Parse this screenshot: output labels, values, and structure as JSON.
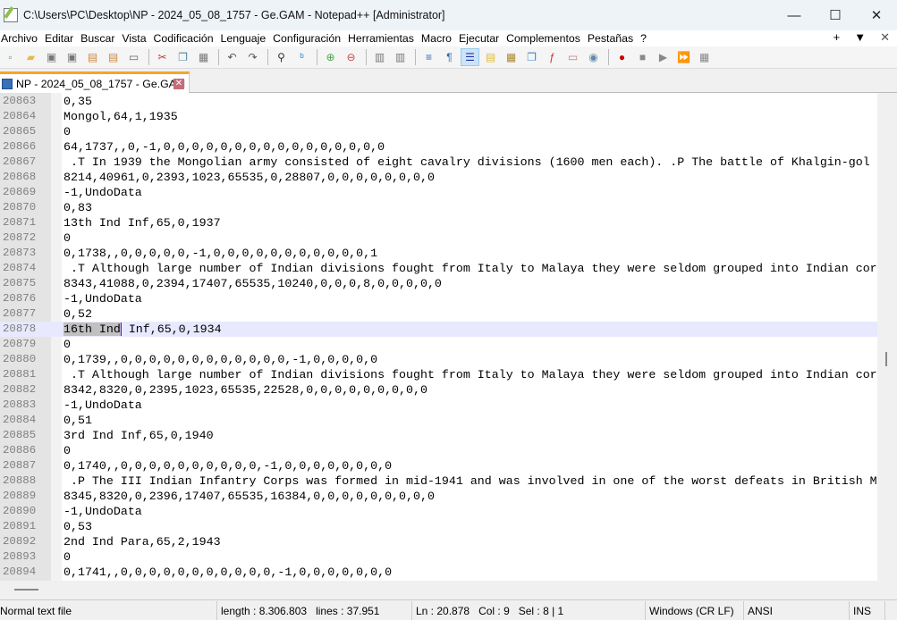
{
  "window": {
    "title": "C:\\Users\\PC\\Desktop\\NP - 2024_05_08_1757 - Ge.GAM - Notepad++ [Administrator]",
    "minimize": "—",
    "maximize": "☐",
    "close": "✕"
  },
  "menu": [
    "Archivo",
    "Editar",
    "Buscar",
    "Vista",
    "Codificación",
    "Lenguaje",
    "Configuración",
    "Herramientas",
    "Macro",
    "Ejecutar",
    "Complementos",
    "Pestañas",
    "?"
  ],
  "menu_right": {
    "add": "+",
    "dropdown": "▼",
    "close": "✕"
  },
  "tab": {
    "label": "NP - 2024_05_08_1757 - Ge.GAM",
    "close": "✕"
  },
  "editor": {
    "lines": [
      {
        "n": "20863",
        "t": "0,35"
      },
      {
        "n": "20864",
        "t": "Mongol,64,1,1935"
      },
      {
        "n": "20865",
        "t": "0"
      },
      {
        "n": "20866",
        "t": "64,1737,,0,-1,0,0,0,0,0,0,0,0,0,0,0,0,0,0,0,0"
      },
      {
        "n": "20867",
        "t": " .T In 1939 the Mongolian army consisted of eight cavalry divisions (1600 men each). .P The battle of Khalgin-gol"
      },
      {
        "n": "20868",
        "t": "8214,40961,0,2393,1023,65535,0,28807,0,0,0,0,0,0,0,0"
      },
      {
        "n": "20869",
        "t": "-1,UndoData"
      },
      {
        "n": "20870",
        "t": "0,83"
      },
      {
        "n": "20871",
        "t": "13th Ind Inf,65,0,1937"
      },
      {
        "n": "20872",
        "t": "0"
      },
      {
        "n": "20873",
        "t": "0,1738,,0,0,0,0,0,-1,0,0,0,0,0,0,0,0,0,0,0,1"
      },
      {
        "n": "20874",
        "t": " .T Although large number of Indian divisions fought from Italy to Malaya they were seldom grouped into Indian cor"
      },
      {
        "n": "20875",
        "t": "8343,41088,0,2394,17407,65535,10240,0,0,0,8,0,0,0,0,0"
      },
      {
        "n": "20876",
        "t": "-1,UndoData"
      },
      {
        "n": "20877",
        "t": "0,52"
      },
      {
        "n": "20878",
        "sel": "16th Ind",
        "t": " Inf,65,0,1934"
      },
      {
        "n": "20879",
        "t": "0"
      },
      {
        "n": "20880",
        "t": "0,1739,,0,0,0,0,0,0,0,0,0,0,0,0,-1,0,0,0,0,0"
      },
      {
        "n": "20881",
        "t": " .T Although large number of Indian divisions fought from Italy to Malaya they were seldom grouped into Indian cor"
      },
      {
        "n": "20882",
        "t": "8342,8320,0,2395,1023,65535,22528,0,0,0,0,0,0,0,0,0"
      },
      {
        "n": "20883",
        "t": "-1,UndoData"
      },
      {
        "n": "20884",
        "t": "0,51"
      },
      {
        "n": "20885",
        "t": "3rd Ind Inf,65,0,1940"
      },
      {
        "n": "20886",
        "t": "0"
      },
      {
        "n": "20887",
        "t": "0,1740,,0,0,0,0,0,0,0,0,0,0,-1,0,0,0,0,0,0,0,0"
      },
      {
        "n": "20888",
        "t": " .P The III Indian Infantry Corps was formed in mid-1941 and was involved in one of the worst defeats in British M"
      },
      {
        "n": "20889",
        "t": "8345,8320,0,2396,17407,65535,16384,0,0,0,0,0,0,0,0,0"
      },
      {
        "n": "20890",
        "t": "-1,UndoData"
      },
      {
        "n": "20891",
        "t": "0,53"
      },
      {
        "n": "20892",
        "t": "2nd Ind Para,65,2,1943"
      },
      {
        "n": "20893",
        "t": "0"
      },
      {
        "n": "20894",
        "t": "0,1741,,0,0,0,0,0,0,0,0,0,0,0,-1,0,0,0,0,0,0,0"
      }
    ]
  },
  "status": {
    "file_type": "Normal text file",
    "length": "length : 8.306.803",
    "lines": "lines : 37.951",
    "ln": "Ln : 20.878",
    "col": "Col : 9",
    "sel": "Sel : 8 | 1",
    "eol": "Windows (CR LF)",
    "encoding": "ANSI",
    "mode": "INS"
  }
}
